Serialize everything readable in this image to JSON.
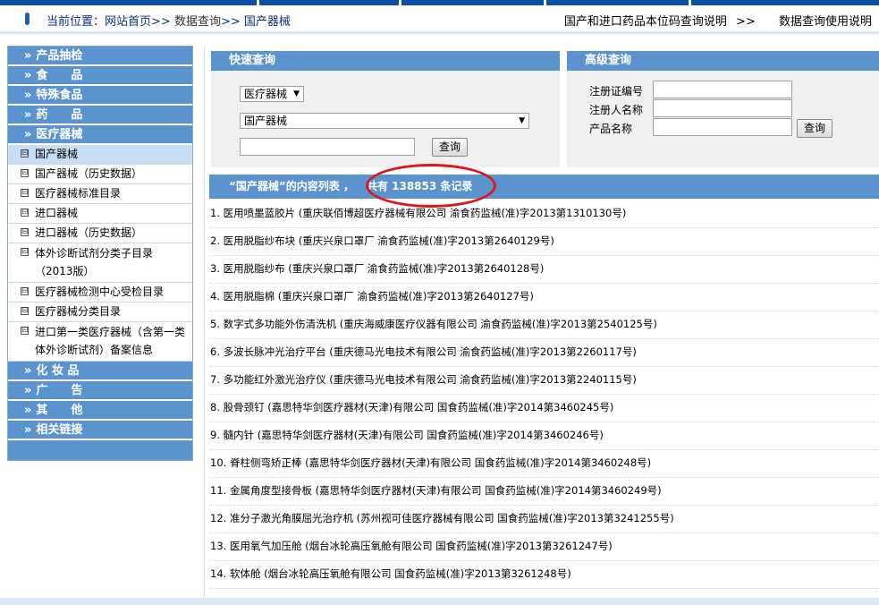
{
  "breadcrumb": {
    "label": "当前位置：",
    "home": "网站首页",
    "sep1": ">>",
    "level2": "数据查询",
    "sep2": ">>",
    "level3": "国产器械"
  },
  "top_links": {
    "link1": "国产和进口药品本位码查询说明",
    "sep": ">>",
    "link2": "数据查询使用说明"
  },
  "sidebar": {
    "arrow": "»",
    "cat_product_sampling": "产品抽检",
    "cat_food": "食　　品",
    "cat_special_food": "特殊食品",
    "cat_drugs": "药　　品",
    "cat_medical_devices": "医疗器械",
    "subs": [
      "国产器械",
      "国产器械（历史数据）",
      "医疗器械标准目录",
      "进口器械",
      "进口器械（历史数据）",
      "体外诊断试剂分类子目录（2013版）",
      "医疗器械检测中心受检目录",
      "医疗器械分类目录",
      "进口第一类医疗器械（含第一类体外诊断试剂）备案信息"
    ],
    "cat_cosmetics": "化 妆 品",
    "cat_ads": "广　　告",
    "cat_other": "其　　他",
    "cat_links": "相关链接"
  },
  "quick_search": {
    "title": "快速查询",
    "type_select": "医疗器械",
    "db_select": "国产器械",
    "keyword_value": "",
    "button": "查询"
  },
  "advanced_search": {
    "title": "高级查询",
    "label_reg_no": "注册证编号",
    "label_registrant": "注册人名称",
    "label_product": "产品名称",
    "button": "查询"
  },
  "list": {
    "heading": "“国产器械”的内容列表 ，",
    "count_text": "共有 138853 条记录",
    "items": [
      "1. 医用喷墨蓝胶片 (重庆联佰博超医疗器械有限公司 渝食药监械(准)字2013第1310130号)",
      "2. 医用脱脂纱布块 (重庆兴泉口罩厂 渝食药监械(准)字2013第2640129号)",
      "3. 医用脱脂纱布 (重庆兴泉口罩厂 渝食药监械(准)字2013第2640128号)",
      "4. 医用脱脂棉 (重庆兴泉口罩厂 渝食药监械(准)字2013第2640127号)",
      "5. 数字式多功能外伤清洗机 (重庆海威康医疗仪器有限公司 渝食药监械(准)字2013第2540125号)",
      "6. 多波长脉冲光治疗平台 (重庆德马光电技术有限公司 渝食药监械(准)字2013第2260117号)",
      "7. 多功能红外激光治疗仪 (重庆德马光电技术有限公司 渝食药监械(准)字2013第2240115号)",
      "8. 股骨颈钉 (嘉思特华剑医疗器材(天津)有限公司 国食药监械(准)字2014第3460245号)",
      "9. 髓内针 (嘉思特华剑医疗器材(天津)有限公司 国食药监械(准)字2014第3460246号)",
      "10. 脊柱侧弯矫正棒 (嘉思特华剑医疗器材(天津)有限公司 国食药监械(准)字2014第3460248号)",
      "11. 金属角度型接骨板 (嘉思特华剑医疗器材(天津)有限公司 国食药监械(准)字2014第3460249号)",
      "12. 准分子激光角膜屈光治疗机 (苏州视可佳医疗器械有限公司 国食药监械(准)字2013第3241255号)",
      "13. 医用氧气加压舱 (烟台冰轮高压氧舱有限公司 国食药监械(准)字2013第3261247号)",
      "14. 软体舱 (烟台冰轮高压氧舱有限公司 国食药监械(准)字2013第3261248号)"
    ]
  },
  "colors": {
    "brand_blue": "#0a4fa0",
    "header_blue": "#5b93cf",
    "highlight_red": "#e0141a"
  }
}
